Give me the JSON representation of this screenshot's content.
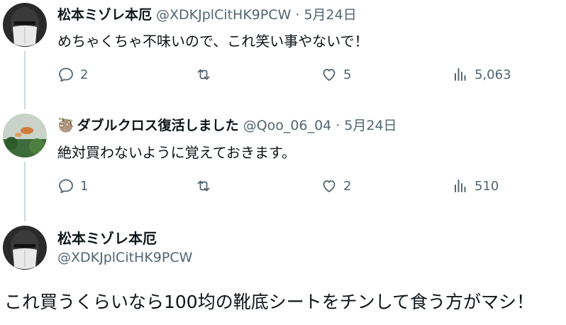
{
  "tweets": [
    {
      "name": "松本ミゾレ本厄",
      "handle": "@XDKJplCitHK9PCW",
      "dot": "·",
      "date": "5月24日",
      "text": "めちゃくちゃ不味いので、これ笑い事やないで！",
      "replies": "2",
      "retweets": "",
      "likes": "5",
      "views": "5,063"
    },
    {
      "name_emoji": "🦥",
      "name": "ダブルクロス復活しました",
      "handle": "@Qoo_06_04",
      "dot": "·",
      "date": "5月24日",
      "text": "絶対買わないように覚えておきます。",
      "replies": "1",
      "retweets": "",
      "likes": "2",
      "views": "510"
    }
  ],
  "main_tweet": {
    "name": "松本ミゾレ本厄",
    "handle": "@XDKJplCitHK9PCW",
    "text": "これ買うくらいなら100均の靴底シートをチンして食う方がマシ！"
  },
  "icons": [
    "reply-icon",
    "retweet-icon",
    "like-icon",
    "views-icon"
  ],
  "colors": {
    "text": "#0f1419",
    "secondary": "#536471",
    "thread_line": "#cfd9de"
  }
}
